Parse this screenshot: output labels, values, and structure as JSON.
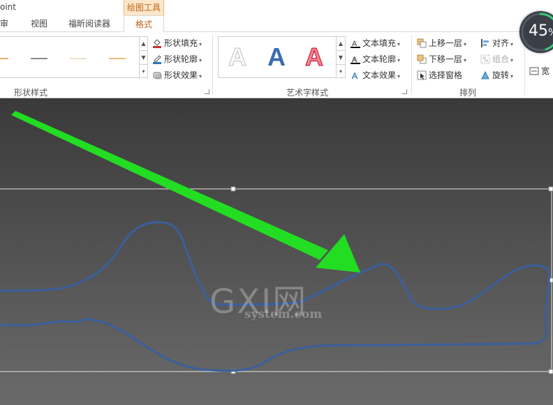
{
  "window": {
    "title_fragment": "oint"
  },
  "context_tab": {
    "label": "绘图工具"
  },
  "tabs": [
    {
      "label": "审阅"
    },
    {
      "label": "视图"
    },
    {
      "label": "福昕阅读器"
    },
    {
      "label": "格式"
    }
  ],
  "groups": {
    "shape_styles": {
      "label": "形状样式",
      "commands": {
        "fill": "形状填充",
        "outline": "形状轮廓",
        "effects": "形状效果"
      }
    },
    "wordart": {
      "label": "艺术字样式",
      "samples": [
        "A",
        "A",
        "A"
      ],
      "commands": {
        "fill": "文本填充",
        "outline": "文本轮廓",
        "effects": "文本效果"
      }
    },
    "arrange": {
      "label": "排列",
      "commands": {
        "bring_forward": "上移一层",
        "send_backward": "下移一层",
        "selection_pane": "选择窗格",
        "align": "对齐",
        "group": "组合",
        "rotate": "旋转"
      }
    },
    "size_partial": {
      "label": "宽"
    }
  },
  "progress": {
    "value_text": "45",
    "unit": "%",
    "fraction": 0.45
  },
  "watermark": {
    "main": "GXI网",
    "sub": "system.com"
  },
  "colors": {
    "accent": "#c0641a",
    "arrow": "#22dd22",
    "freeform_line": "#3a5f9e",
    "shape_outline_red": "#c0392b",
    "shape_outline_blue": "#2e75b6"
  },
  "icons": [
    "fill-bucket-icon",
    "pen-outline-icon",
    "effects-icon",
    "text-fill-icon",
    "text-outline-icon",
    "text-effects-icon",
    "bring-forward-icon",
    "send-backward-icon",
    "selection-pane-icon",
    "align-icon",
    "group-icon",
    "rotate-icon",
    "size-icon"
  ]
}
